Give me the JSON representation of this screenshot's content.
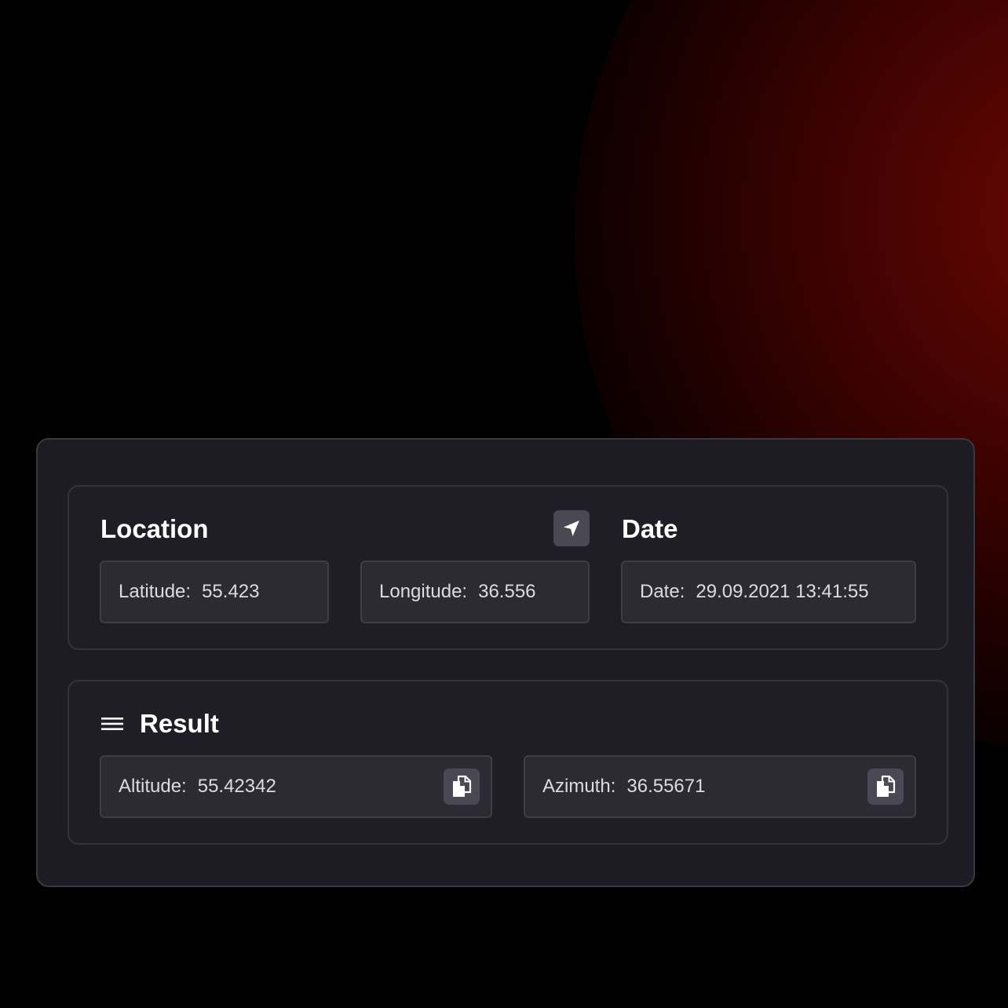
{
  "location": {
    "title": "Location",
    "locate_icon": "location-arrow-icon",
    "latitude": {
      "label": "Latitude:",
      "value": "55.423"
    },
    "longitude": {
      "label": "Longitude:",
      "value": "36.556"
    }
  },
  "date": {
    "title": "Date",
    "field": {
      "label": "Date:",
      "value": "29.09.2021 13:41:55"
    }
  },
  "result": {
    "title": "Result",
    "menu_icon": "menu-icon",
    "altitude": {
      "label": "Altitude:",
      "value": "55.42342",
      "copy_icon": "copy-icon"
    },
    "azimuth": {
      "label": "Azimuth:",
      "value": "36.55671",
      "copy_icon": "copy-icon"
    }
  },
  "colors": {
    "background": "#000000",
    "panel": "#1d1b23",
    "field": "#2c2a33",
    "icon_button": "#4a4852",
    "planet_glow": "#6d0704"
  }
}
